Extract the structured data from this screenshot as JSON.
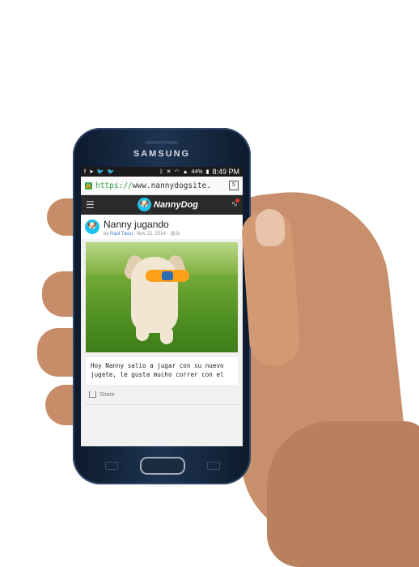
{
  "device": {
    "brand": "SAMSUNG"
  },
  "status_bar": {
    "time": "8:49 PM",
    "battery": "44%"
  },
  "browser": {
    "url_scheme": "https://",
    "url_rest": "www.nannydogsite.",
    "tab_count": "5"
  },
  "app": {
    "logo_text": "NannyDog"
  },
  "post": {
    "title": "Nanny jugando",
    "meta_prefix": "by",
    "author": "Raul Taciu",
    "date": "Nov 22, 2014",
    "extra": "@2x",
    "body": "Hoy Nanny salio a jugar con su nuevo jugete, le gusta mucho correr con el",
    "share_label": "Share"
  },
  "colors": {
    "accent": "#1fc2e8",
    "url_secure": "#2ea043"
  }
}
